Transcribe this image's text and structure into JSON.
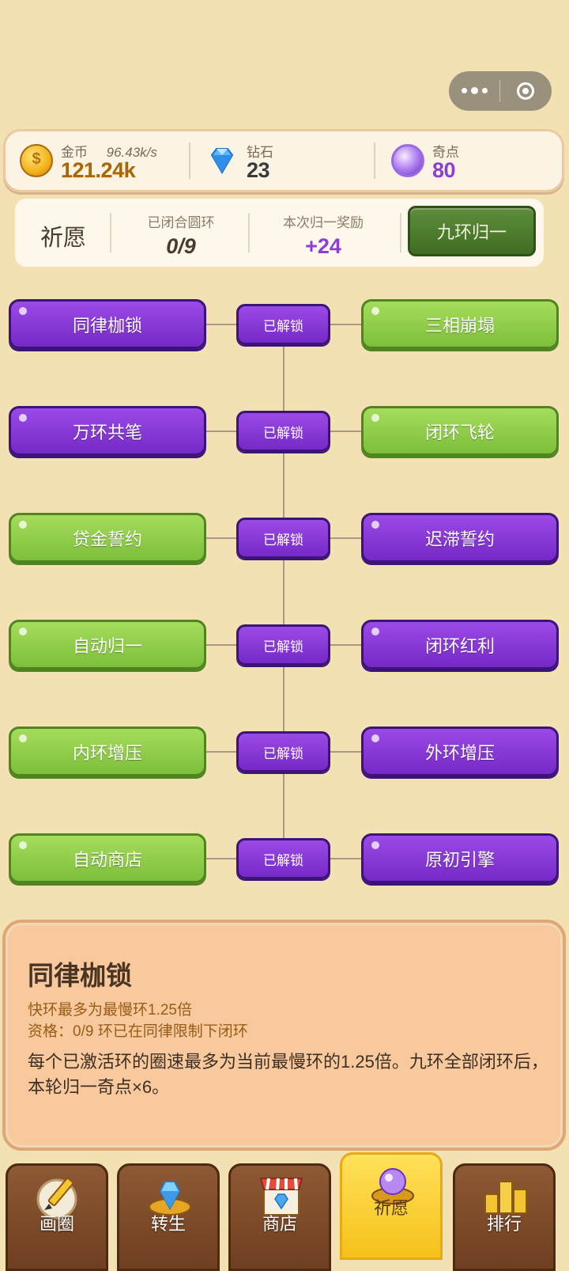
{
  "capsule": {
    "more_icon": "more-dots-icon",
    "close_icon": "target-icon"
  },
  "resources": {
    "gold": {
      "label": "金币",
      "rate": "96.43k/s",
      "value": "121.24k",
      "icon": "coin-icon"
    },
    "diamond": {
      "label": "钻石",
      "value": "23",
      "icon": "diamond-icon"
    },
    "singularity": {
      "label": "奇点",
      "value": "80",
      "icon": "orb-icon"
    }
  },
  "wish": {
    "title": "祈愿",
    "closed_label": "已闭合圆环",
    "closed_value": "0/9",
    "reward_label": "本次归一奖励",
    "reward_value": "+24",
    "button": "九环归一"
  },
  "tree": {
    "rows": [
      {
        "left": "同律枷锁",
        "left_color": "purple",
        "center": "已解锁",
        "right": "三相崩塌",
        "right_color": "green"
      },
      {
        "left": "万环共笔",
        "left_color": "purple",
        "center": "已解锁",
        "right": "闭环飞轮",
        "right_color": "green"
      },
      {
        "left": "贷金誓约",
        "left_color": "green",
        "center": "已解锁",
        "right": "迟滞誓约",
        "right_color": "purple"
      },
      {
        "left": "自动归一",
        "left_color": "green",
        "center": "已解锁",
        "right": "闭环红利",
        "right_color": "purple"
      },
      {
        "left": "内环增压",
        "left_color": "green",
        "center": "已解锁",
        "right": "外环增压",
        "right_color": "purple"
      },
      {
        "left": "自动商店",
        "left_color": "green",
        "center": "已解锁",
        "right": "原初引擎",
        "right_color": "purple"
      }
    ]
  },
  "detail": {
    "name": "同律枷锁",
    "sub1": "快环最多为最慢环1.25倍",
    "sub2": "资格：0/9 环已在同律限制下闭环",
    "desc": "每个已激活环的圈速最多为当前最慢环的1.25倍。九环全部闭环后，本轮归一奇点×6。"
  },
  "nav": {
    "tabs": [
      {
        "label": "画圈",
        "icon": "pencil-icon"
      },
      {
        "label": "转生",
        "icon": "crystal-ring-icon"
      },
      {
        "label": "商店",
        "icon": "shop-icon"
      },
      {
        "label": "祈愿",
        "icon": "wish-orb-icon",
        "active": true
      },
      {
        "label": "排行",
        "icon": "podium-icon"
      }
    ]
  },
  "colors": {
    "background": "#f3e1b4",
    "gold_text": "#a8650a",
    "diamond_text": "#3a3a3a",
    "orb_text": "#8a3fd1",
    "purple_node": "#8a3ad9",
    "green_node": "#8fcd4a",
    "detail_bg": "#f8c99c"
  }
}
